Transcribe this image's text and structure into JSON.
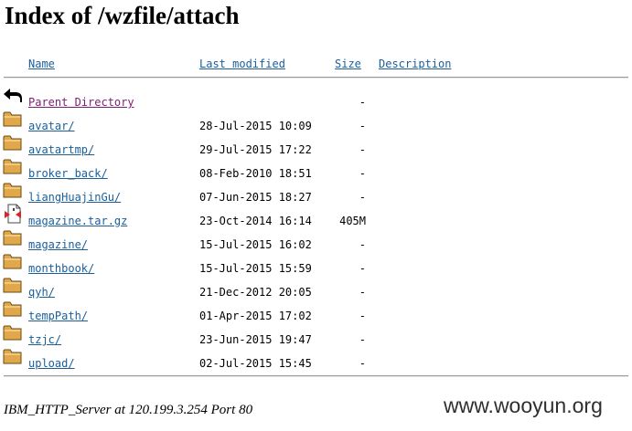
{
  "page": {
    "title": "Index of /wzfile/attach"
  },
  "table": {
    "columns": {
      "name": "Name",
      "last_modified": "Last modified",
      "size": "Size",
      "description": "Description"
    },
    "parent": {
      "label": "Parent Directory",
      "size": "-",
      "icon": "back-arrow-icon"
    },
    "rows": [
      {
        "name": "avatar/",
        "modified": "28-Jul-2015 10:09",
        "size": "-",
        "icon": "folder-icon"
      },
      {
        "name": "avatartmp/",
        "modified": "29-Jul-2015 17:22",
        "size": "-",
        "icon": "folder-icon"
      },
      {
        "name": "broker_back/",
        "modified": "08-Feb-2010 18:51",
        "size": "-",
        "icon": "folder-icon"
      },
      {
        "name": "liangHuajinGu/",
        "modified": "07-Jun-2015 18:27",
        "size": "-",
        "icon": "folder-icon"
      },
      {
        "name": "magazine.tar.gz",
        "modified": "23-Oct-2014 16:14",
        "size": "405M",
        "icon": "compressed-file-icon"
      },
      {
        "name": "magazine/",
        "modified": "15-Jul-2015 16:02",
        "size": "-",
        "icon": "folder-icon"
      },
      {
        "name": "monthbook/",
        "modified": "15-Jul-2015 15:59",
        "size": "-",
        "icon": "folder-icon"
      },
      {
        "name": "qyh/",
        "modified": "21-Dec-2012 20:05",
        "size": "-",
        "icon": "folder-icon"
      },
      {
        "name": "tempPath/",
        "modified": "01-Apr-2015 17:02",
        "size": "-",
        "icon": "folder-icon"
      },
      {
        "name": "tzjc/",
        "modified": "23-Jun-2015 19:47",
        "size": "-",
        "icon": "folder-icon"
      },
      {
        "name": "upload/",
        "modified": "02-Jul-2015 15:45",
        "size": "-",
        "icon": "folder-icon"
      }
    ]
  },
  "footer": {
    "server_signature": "IBM_HTTP_Server at 120.199.3.254 Port 80"
  },
  "watermark": {
    "text": "www.wooyun.org"
  },
  "colors": {
    "link": "#1a5e9a",
    "visited_link": "#7b1e72",
    "folder": "#e0a84a"
  }
}
